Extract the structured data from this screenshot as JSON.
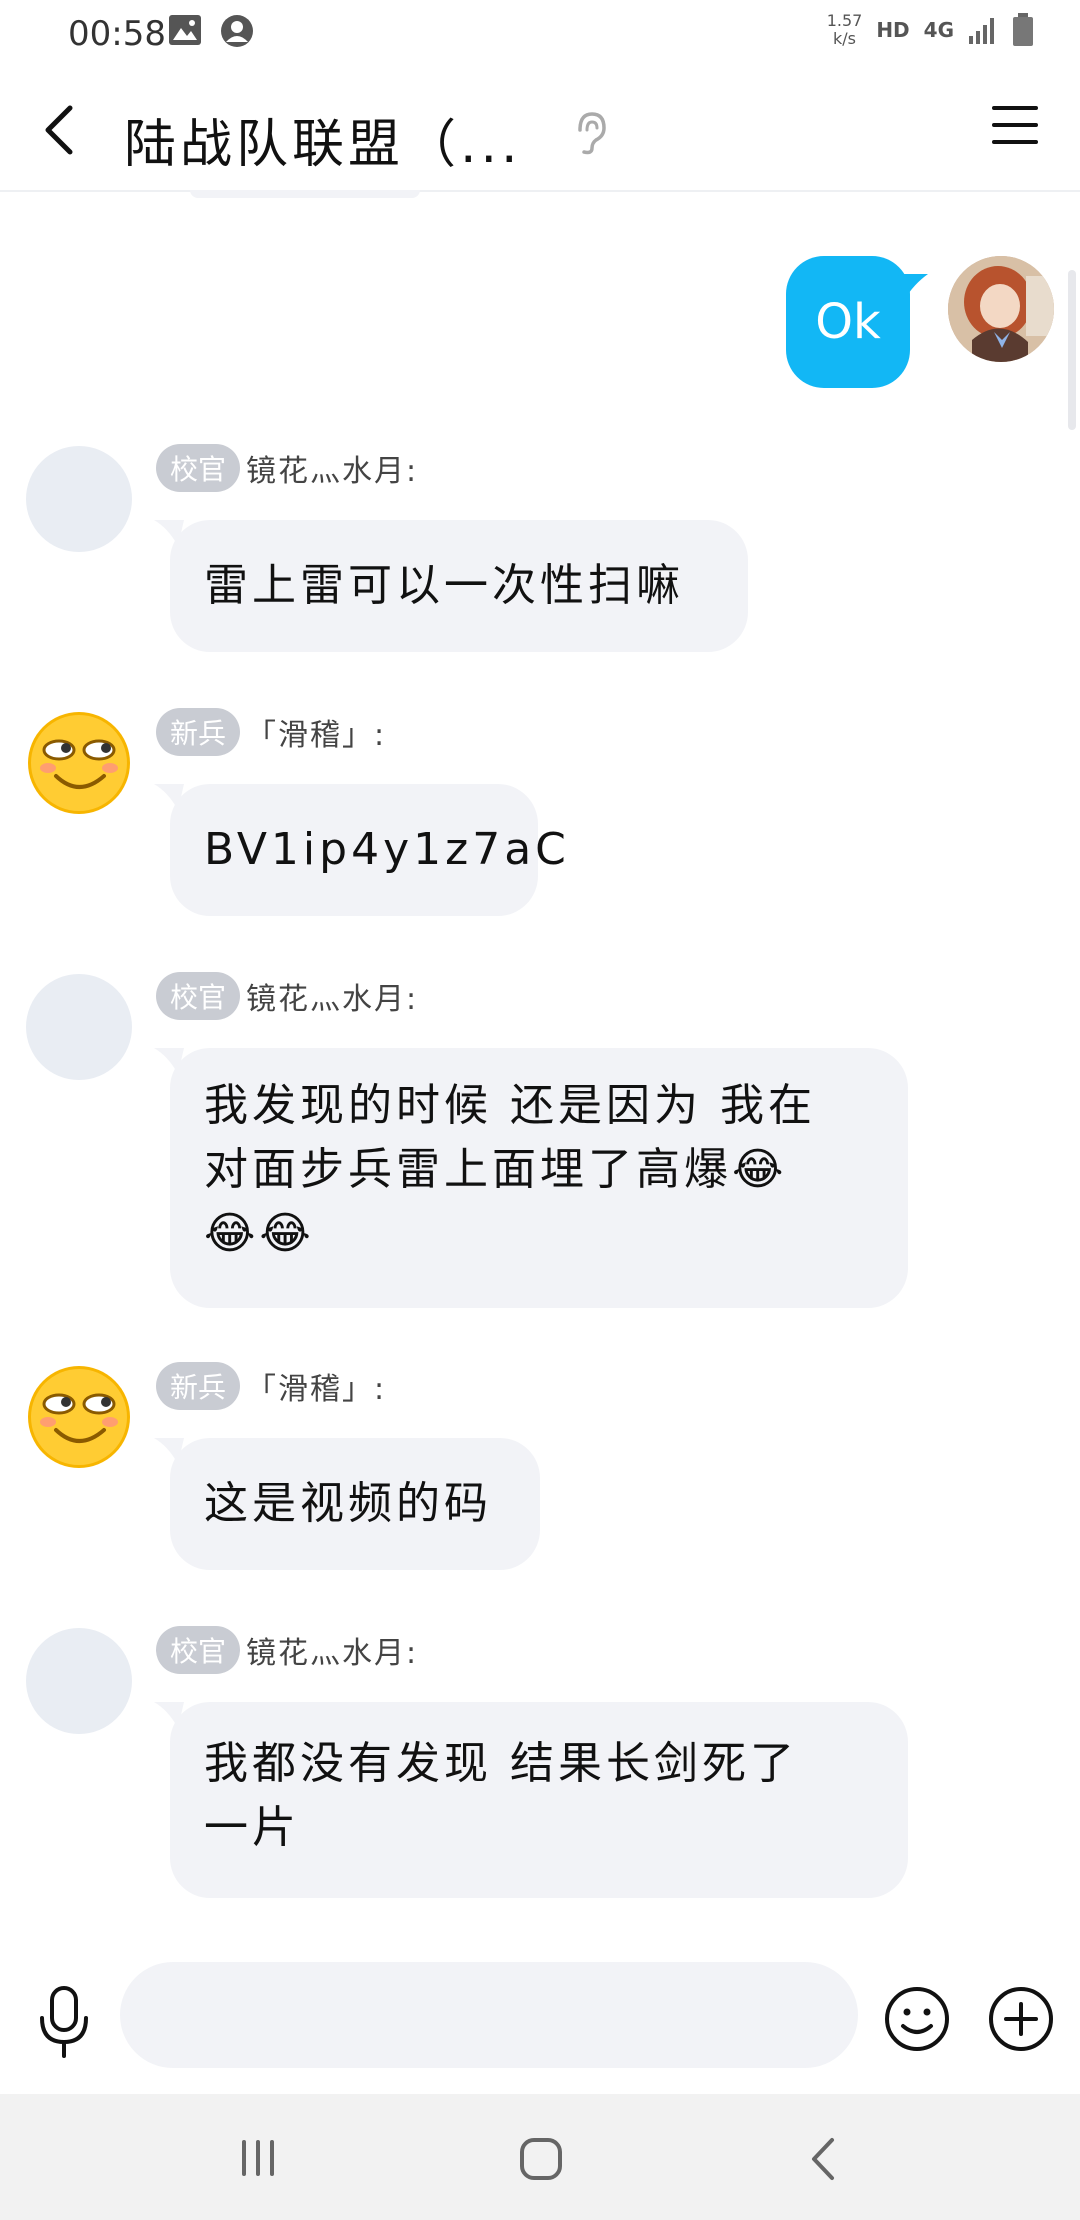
{
  "status_bar": {
    "time": "00:58",
    "net_speed_top": "1.57",
    "net_speed_bottom": "k/s",
    "hd": "HD",
    "network": "4G"
  },
  "header": {
    "title": "陆战队联盟（...",
    "icons": [
      "back-icon",
      "ear-icon",
      "menu-icon"
    ]
  },
  "messages": [
    {
      "self": true,
      "text": "Ok"
    },
    {
      "badge": "校官",
      "name": "镜花灬水月:",
      "avatar": "blank",
      "text": "雷上雷可以一次性扫嘛"
    },
    {
      "badge": "新兵",
      "name": "「滑稽」:",
      "avatar": "smirk-emoji",
      "text": "BV1ip4y1z7aC"
    },
    {
      "badge": "校官",
      "name": "镜花灬水月:",
      "avatar": "blank",
      "lines": [
        "我发现的时候 还是因为 我在",
        "对面步兵雷上面埋了高爆😂",
        "😂😂"
      ]
    },
    {
      "badge": "新兵",
      "name": "「滑稽」:",
      "avatar": "smirk-emoji",
      "text": "这是视频的码"
    },
    {
      "badge": "校官",
      "name": "镜花灬水月:",
      "avatar": "blank",
      "lines": [
        "我都没有发现 结果长剑死了",
        "一片"
      ]
    }
  ],
  "input": {
    "placeholder": ""
  },
  "colors": {
    "accent": "#12b7f5",
    "bubble": "#f2f3f7",
    "badge": "#c9ccd3"
  }
}
